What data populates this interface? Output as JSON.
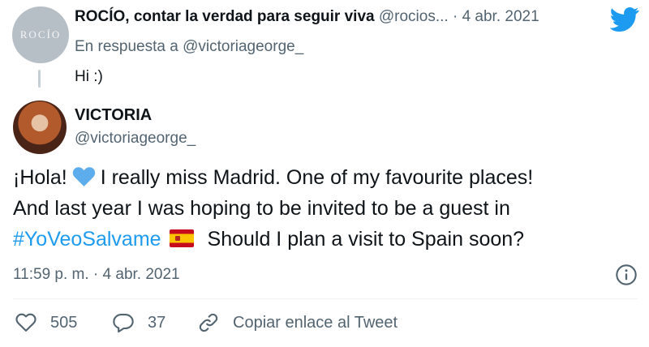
{
  "parent_tweet": {
    "avatar_text": "ROCÍO",
    "display_name": "ROCÍO, contar la verdad para seguir viva",
    "handle": "@rocios...",
    "separator": "·",
    "date": "4 abr. 2021",
    "reply_to": "En respuesta a @victoriageorge_",
    "text": "Hi :)"
  },
  "main_tweet": {
    "display_name": "VICTORIA",
    "handle": "@victoriageorge_",
    "body": {
      "line1_a": "¡Hola!",
      "line1_b": "I really miss Madrid. One of my favourite places!",
      "line2": "And last year I was hoping to be invited to be a guest in",
      "hashtag": "#YoVeoSalvame",
      "line3_b": "Should I plan a visit to Spain soon?"
    },
    "timestamp": "11:59 p. m. · 4 abr. 2021"
  },
  "actions": {
    "like_count": "505",
    "reply_count": "37",
    "copy_label": "Copiar enlace al Tweet"
  },
  "colors": {
    "twitter_blue": "#1d9bf0",
    "secondary_text": "#536471",
    "heart_emoji": "#5dadec"
  },
  "icons": [
    "twitter-bird-icon",
    "blue-heart-emoji-icon",
    "spain-flag-emoji-icon",
    "info-icon",
    "heart-icon",
    "comment-icon",
    "link-icon"
  ]
}
